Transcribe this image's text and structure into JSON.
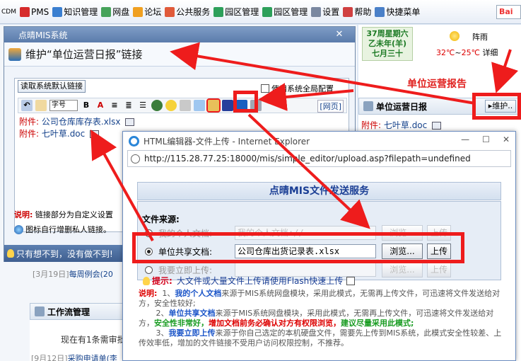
{
  "topbar": {
    "items": [
      {
        "label": "CDM",
        "icon": "cdm-icon",
        "color": "#6b7fa0"
      },
      {
        "label": "PMS",
        "icon": "pms-icon",
        "color": "#d62b2b"
      },
      {
        "label": "知识管理",
        "icon": "knowledge-icon",
        "color": "#3a7fd0"
      },
      {
        "label": "网盘",
        "icon": "netdisk-icon",
        "color": "#46a35a"
      },
      {
        "label": "论坛",
        "icon": "forum-icon",
        "color": "#f0a020"
      },
      {
        "label": "公共服务",
        "icon": "public-service-icon",
        "color": "#e05a3a"
      },
      {
        "label": "园区管理",
        "icon": "park-manage-icon",
        "color": "#2da05a"
      },
      {
        "label": "园区管理",
        "icon": "park-manage-icon-2",
        "color": "#2da05a"
      },
      {
        "label": "设置",
        "icon": "settings-icon",
        "color": "#7a88a0"
      },
      {
        "label": "帮助",
        "icon": "help-icon",
        "color": "#d04040"
      },
      {
        "label": "快捷菜单",
        "icon": "shortcut-menu-icon",
        "color": "#4a80c8"
      }
    ],
    "search_logo": "Bai"
  },
  "calendar": {
    "week": "37周星期六",
    "lunar_year": "乙未年(羊)",
    "lunar_day": "七月三十"
  },
  "weather": {
    "text": "阵雨",
    "high": "32℃",
    "low": "25℃",
    "detail": "详细"
  },
  "annotation_report": "单位运营报告",
  "right_panel": {
    "title": "单位运营日报",
    "maint_button": "▸维护..",
    "item_prefix": "附件:",
    "item_name": "七叶草.doc"
  },
  "bg_list": {
    "item1_date": "[3月19日]",
    "item1_text": "每周例会(20",
    "workflow_title": "工作流管理",
    "workflow_text": "现在有1条需审批",
    "item2_date": "[9月12日]",
    "item2_text": "采购申请单(李"
  },
  "maint_dialog": {
    "title": "点晴MIS系统",
    "close": "✕",
    "subtitle": "维护“单位运营日报”链接",
    "read_default_button": "读取系统默认链接",
    "global_config_label": "使用系统全局配置",
    "font_select": "字号",
    "web_tab": "[网页]",
    "attachments": [
      {
        "prefix": "附件:",
        "name": "公司仓库库存表.xlsx"
      },
      {
        "prefix": "附件:",
        "name": "七叶草.doc"
      }
    ],
    "note_label": "说明:",
    "note_text": "链接部分为自定义设置",
    "note2_text": "图标自行增删私人链接。",
    "footer": "只有想不到，没有做不到!"
  },
  "ie_dialog": {
    "title": "HTML编辑器-文件上传 - Internet Explorer",
    "minimize": "—",
    "maximize": "☐",
    "close": "✕",
    "address": "http://115.28.77.25:18000/mis/simple_editor/upload.asp?filepath=undefined",
    "service_title": "点晴MIS文件发送服务",
    "source_label": "文件来源:",
    "rows": [
      {
        "label": "我的个人文档:",
        "value": "我的个人文档://",
        "browse": "浏览...",
        "upload": "上传",
        "selected": false
      },
      {
        "label": "单位共享文档:",
        "value": "公司仓库出货记录表.xlsx",
        "browse": "浏览...",
        "upload": "上传",
        "selected": true
      },
      {
        "label": "我要立即上传:",
        "value": "",
        "browse": "浏览...",
        "upload": "上传",
        "selected": false
      }
    ],
    "tip_label": "提示:",
    "tip_text": "大文件或大量文件上传请使用Flash快速上传",
    "expl": {
      "label": "说明:",
      "p1_num": "1、",
      "p1_head": "我的个人文档",
      "p1_text": "来源于MIS系统网盘模块，采用此模式，无需再上传文件，可迅速将文件发送给对方，安全性较好;",
      "p2_num": "2、",
      "p2_head": "单位共享文档",
      "p2_text": "来源于MIS系统网盘模块，采用此模式，无需再上传文件，可迅速将文件发送给对方，",
      "p2_green": "安全性非常好，",
      "p2_red": "增加文档前务必确认对方有权限浏览，",
      "p2_green2": "建议尽量采用此模式;",
      "p3_num": "3、",
      "p3_head": "我要立即上传",
      "p3_text": "来源于你自己选定的本机硬盘文件，需要先上传到MIS系统，此模式安全性较差、上传效率低，增加的文件链接不受用户访问权限控制，不推荐。"
    }
  },
  "colors": {
    "highlight": "#ee1c1c",
    "link": "#15428b",
    "title_blue": "#1b3f95"
  }
}
